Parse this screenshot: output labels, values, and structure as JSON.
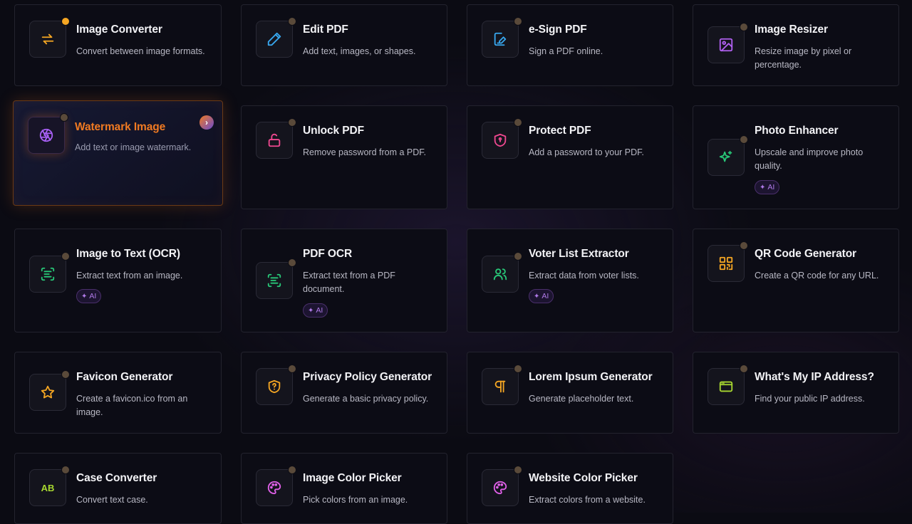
{
  "tools": [
    {
      "id": "image-converter",
      "title": "Image Converter",
      "desc": "Convert between image formats.",
      "icon": "arrows-swap-icon",
      "color": "#f5a623"
    },
    {
      "id": "edit-pdf",
      "title": "Edit PDF",
      "desc": "Add text, images, or shapes.",
      "icon": "pencil-icon",
      "color": "#38a8f0"
    },
    {
      "id": "esign-pdf",
      "title": "e-Sign PDF",
      "desc": "Sign a PDF online.",
      "icon": "signature-icon",
      "color": "#38a8f0"
    },
    {
      "id": "image-resizer",
      "title": "Image Resizer",
      "desc": "Resize image by pixel or percentage.",
      "icon": "image-icon",
      "color": "#b060f0"
    },
    {
      "id": "watermark-image",
      "title": "Watermark Image",
      "desc": "Add text or image watermark.",
      "icon": "aperture-icon",
      "color": "#a860f5",
      "active": true,
      "arrow": "›"
    },
    {
      "id": "unlock-pdf",
      "title": "Unlock PDF",
      "desc": "Remove password from a PDF.",
      "icon": "unlock-icon",
      "color": "#f04890"
    },
    {
      "id": "protect-pdf",
      "title": "Protect PDF",
      "desc": "Add a password to your PDF.",
      "icon": "shield-lock-icon",
      "color": "#f04890"
    },
    {
      "id": "photo-enhancer",
      "title": "Photo Enhancer",
      "desc": "Upscale and improve photo quality.",
      "icon": "sparkle-icon",
      "color": "#28c878",
      "badge": "AI"
    },
    {
      "id": "image-to-text",
      "title": "Image to Text (OCR)",
      "desc": "Extract text from an image.",
      "icon": "scan-text-icon",
      "color": "#28c878",
      "badge": "AI"
    },
    {
      "id": "pdf-ocr",
      "title": "PDF OCR",
      "desc": "Extract text from a PDF document.",
      "icon": "scan-text-icon",
      "color": "#28c878",
      "badge": "AI"
    },
    {
      "id": "voter-list",
      "title": "Voter List Extractor",
      "desc": "Extract data from voter lists.",
      "icon": "users-icon",
      "color": "#28c878",
      "badge": "AI"
    },
    {
      "id": "qr-code",
      "title": "QR Code Generator",
      "desc": "Create a QR code for any URL.",
      "icon": "qr-code-icon",
      "color": "#f5a623"
    },
    {
      "id": "favicon",
      "title": "Favicon Generator",
      "desc": "Create a favicon.ico from an image.",
      "icon": "star-icon",
      "color": "#f5a623"
    },
    {
      "id": "privacy-policy",
      "title": "Privacy Policy Generator",
      "desc": "Generate a basic privacy policy.",
      "icon": "shield-question-icon",
      "color": "#f5a623"
    },
    {
      "id": "lorem-ipsum",
      "title": "Lorem Ipsum Generator",
      "desc": "Generate placeholder text.",
      "icon": "pilcrow-icon",
      "color": "#f5a623"
    },
    {
      "id": "ip-address",
      "title": "What's My IP Address?",
      "desc": "Find your public IP address.",
      "icon": "browser-window-icon",
      "color": "#a8d830"
    },
    {
      "id": "case-converter",
      "title": "Case Converter",
      "desc": "Convert text case.",
      "icon": "ab-text-icon",
      "color": "#a8d830",
      "glyph": "AB"
    },
    {
      "id": "image-color-picker",
      "title": "Image Color Picker",
      "desc": "Pick colors from an image.",
      "icon": "palette-icon",
      "color": "#e060e8"
    },
    {
      "id": "website-color-picker",
      "title": "Website Color Picker",
      "desc": "Extract colors from a website.",
      "icon": "palette-icon",
      "color": "#e060e8"
    }
  ]
}
